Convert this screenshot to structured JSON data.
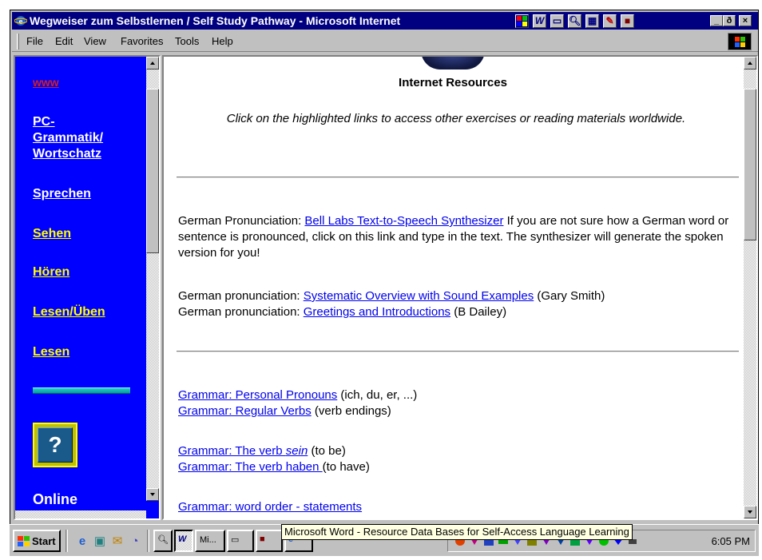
{
  "window": {
    "title": "Wegweiser zum Selbstlernen / Self Study Pathway - Microsoft Internet",
    "tray_icons": [
      "taskbar-icon",
      "word-icon",
      "window-icon",
      "find-icon",
      "keyboard-icon",
      "tools-icon",
      "close-doc-icon"
    ],
    "controls": {
      "minimize": "_",
      "restore": "ð",
      "close": "×"
    }
  },
  "menu": {
    "items": [
      "File",
      "Edit",
      "View",
      "Favorites",
      "Tools",
      "Help"
    ]
  },
  "nav": {
    "top_link": "www",
    "links": [
      {
        "label": "PC-",
        "color": "white"
      },
      {
        "label": "Grammatik/",
        "color": "white"
      },
      {
        "label": "Wortschatz",
        "color": "white"
      },
      {
        "label": "Sprechen",
        "color": "white"
      },
      {
        "label": "Sehen",
        "color": "yellow"
      },
      {
        "label": "Hören",
        "color": "yellow"
      },
      {
        "label": "Lesen/Üben",
        "color": "yellow"
      },
      {
        "label": "Lesen",
        "color": "yellow"
      }
    ],
    "help_glyph": "?",
    "online_label": "Online"
  },
  "content": {
    "heading": "Internet Resources",
    "intro": "Click on the highlighted links to access other exercises or reading materials worldwide.",
    "pron1": {
      "prefix": "German Pronunciation: ",
      "link": "Bell Labs Text-to-Speech Synthesizer",
      "suffix": " If you are not sure how a German word or sentence is pronounced, click on this link and type in the text. The synthesizer will generate the spoken version for you!"
    },
    "pron2": {
      "prefix": "German pronunciation: ",
      "link": "Systematic Overview with Sound Examples",
      "suffix": " (Gary Smith)"
    },
    "pron3": {
      "prefix": "German pronunciation: ",
      "link": "Greetings and Introductions",
      "suffix": " (B Dailey)"
    },
    "gram1": {
      "link": "Grammar: Personal Pronouns",
      "suffix": " (ich, du, er, ...)"
    },
    "gram2": {
      "link": "Grammar: Regular Verbs",
      "suffix": " (verb endings)"
    },
    "gram3": {
      "link_a": "Grammar: The verb ",
      "link_em": "sein",
      "suffix": " (to be)"
    },
    "gram4": {
      "link": "Grammar: The verb haben ",
      "suffix": "(to have)"
    },
    "gram5": {
      "link": "Grammar: word order - statements"
    }
  },
  "taskbar": {
    "start_label": "Start",
    "quick_launch": [
      "ie-icon",
      "desktop-icon",
      "outlook-icon",
      "channels-icon"
    ],
    "task_buttons": [
      "find-task",
      "word-task",
      "Mi...",
      "desktop-task",
      "image-task",
      "ie-task"
    ],
    "clock": "6:05 PM"
  },
  "tooltip": "Microsoft Word - Resource Data Bases for Self-Access Language Learning"
}
